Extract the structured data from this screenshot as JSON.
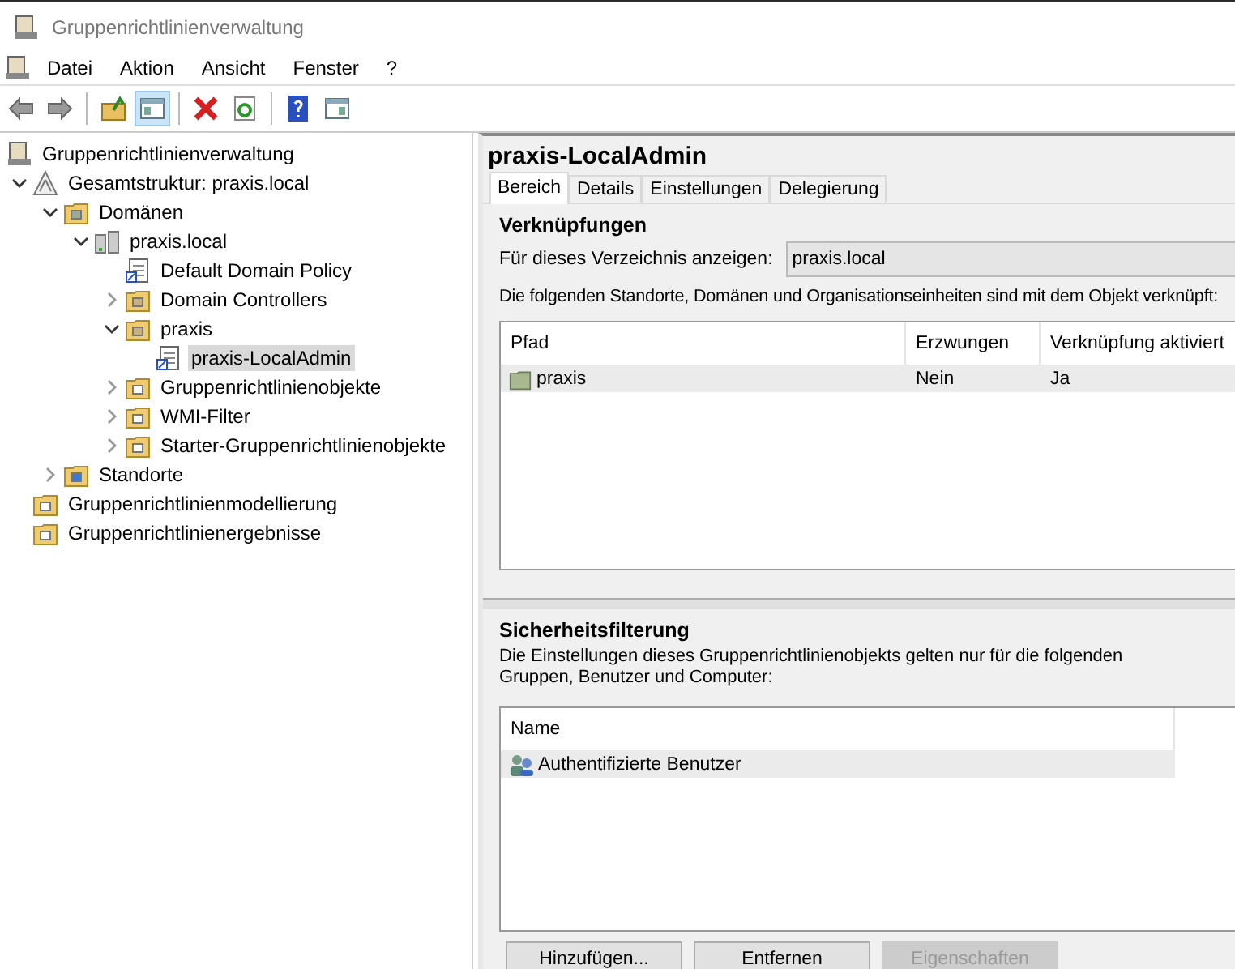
{
  "window": {
    "title": "Gruppenrichtlinienverwaltung"
  },
  "menu": [
    "Datei",
    "Aktion",
    "Ansicht",
    "Fenster",
    "?"
  ],
  "toolbar": [
    {
      "kind": "back",
      "pressed": false
    },
    {
      "kind": "forward",
      "pressed": false
    },
    {
      "kind": "sep"
    },
    {
      "kind": "up",
      "pressed": false
    },
    {
      "kind": "tree",
      "pressed": true
    },
    {
      "kind": "sep"
    },
    {
      "kind": "delete",
      "pressed": false
    },
    {
      "kind": "refresh",
      "pressed": false
    },
    {
      "kind": "sep"
    },
    {
      "kind": "help",
      "pressed": false
    },
    {
      "kind": "pane",
      "pressed": false
    }
  ],
  "tree": [
    {
      "label": "Gruppenrichtlinienverwaltung",
      "kind": "console",
      "selected": false,
      "children": [
        {
          "label": "Gesamtstruktur: praxis.local",
          "kind": "forest",
          "selected": false,
          "expanded": true,
          "children": [
            {
              "label": "Domänen",
              "kind": "domains",
              "selected": false,
              "expanded": true,
              "children": [
                {
                  "label": "praxis.local",
                  "kind": "domain",
                  "selected": false,
                  "expanded": true,
                  "children": [
                    {
                      "label": "Default Domain Policy",
                      "kind": "gpo",
                      "selected": false
                    },
                    {
                      "label": "Domain Controllers",
                      "kind": "ou",
                      "selected": false,
                      "expanded": false
                    },
                    {
                      "label": "praxis",
                      "kind": "ou",
                      "selected": false,
                      "expanded": true,
                      "children": [
                        {
                          "label": "praxis-LocalAdmin",
                          "kind": "gpo",
                          "selected": true
                        }
                      ]
                    },
                    {
                      "label": "Gruppenrichtlinienobjekte",
                      "kind": "folder",
                      "selected": false,
                      "expanded": false
                    },
                    {
                      "label": "WMI-Filter",
                      "kind": "folder",
                      "selected": false,
                      "expanded": false
                    },
                    {
                      "label": "Starter-Gruppenrichtlinienobjekte",
                      "kind": "folder",
                      "selected": false,
                      "expanded": false
                    }
                  ]
                }
              ]
            },
            {
              "label": "Standorte",
              "kind": "sites",
              "selected": false,
              "expanded": false
            }
          ]
        },
        {
          "label": "Gruppenrichtlinienmodellierung",
          "kind": "modeling",
          "selected": false
        },
        {
          "label": "Gruppenrichtlinienergebnisse",
          "kind": "results",
          "selected": false
        }
      ]
    }
  ],
  "detail": {
    "title": "praxis-LocalAdmin",
    "tabs": [
      {
        "label": "Bereich",
        "selected": true
      },
      {
        "label": "Details",
        "selected": false
      },
      {
        "label": "Einstellungen",
        "selected": false
      },
      {
        "label": "Delegierung",
        "selected": false
      }
    ],
    "links": {
      "heading": "Verknüpfungen",
      "scope_label": "Für dieses Verzeichnis anzeigen:",
      "scope_value": "praxis.local",
      "description": "Die folgenden Standorte, Domänen und Organisationseinheiten sind mit dem Objekt verknüpft:",
      "columns": [
        "Pfad",
        "Erzwungen",
        "Verknüpfung aktiviert"
      ],
      "rows": [
        {
          "cells": [
            "praxis",
            "Nein",
            "Ja"
          ],
          "selected": true
        }
      ]
    },
    "security": {
      "heading": "Sicherheitsfilterung",
      "description": "Die Einstellungen dieses Gruppenrichtlinienobjekts gelten nur für die folgenden Gruppen, Benutzer und Computer:",
      "columns": [
        "Name"
      ],
      "rows": [
        {
          "cells": [
            "Authentifizierte Benutzer"
          ],
          "selected": true
        }
      ],
      "buttons": [
        {
          "label": "Hinzufügen...",
          "disabled": false
        },
        {
          "label": "Entfernen",
          "disabled": false
        },
        {
          "label": "Eigenschaften",
          "disabled": true
        }
      ]
    }
  }
}
